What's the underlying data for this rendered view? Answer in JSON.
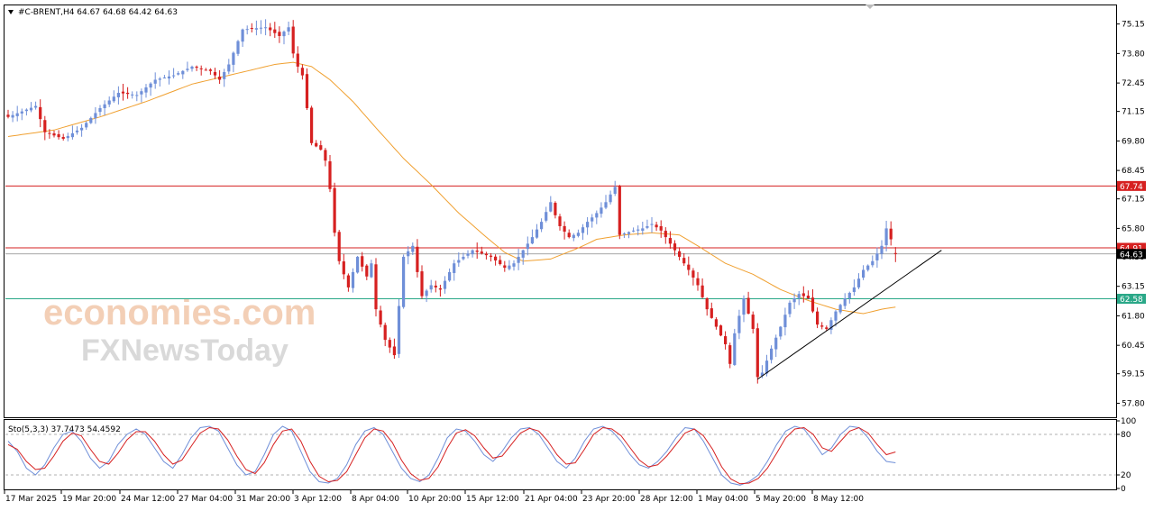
{
  "header": {
    "symbol_line": "#C-BRENT,H4  64.67 64.68 64.42 64.63"
  },
  "watermark": {
    "line1": "economies.com",
    "line2": "FXNewsToday"
  },
  "colors": {
    "bull": "#6f8fd8",
    "bear": "#d62020",
    "ma": "#f0a030",
    "resistance": "#d62020",
    "support": "#2aa888",
    "price_line": "#888888",
    "trendline": "#000000",
    "stoch_main": "#6f8fd8",
    "stoch_signal": "#d62020"
  },
  "chart_data": [
    {
      "type": "candlestick",
      "title": "#C-BRENT,H4",
      "ohlc_header": {
        "open": 64.67,
        "high": 64.68,
        "low": 64.42,
        "close": 64.63
      },
      "ylim": [
        57.2,
        76.0
      ],
      "yticks": [
        "75.15",
        "73.80",
        "72.45",
        "71.15",
        "69.80",
        "68.45",
        "67.15",
        "65.80",
        "64.50",
        "63.15",
        "61.80",
        "60.45",
        "59.15",
        "57.80"
      ],
      "x_labels": [
        "17 Mar 2025",
        "19 Mar 20:00",
        "24 Mar 12:00",
        "27 Mar 04:00",
        "31 Mar 20:00",
        "3 Apr 12:00",
        "8 Apr 04:00",
        "10 Apr 20:00",
        "15 Apr 12:00",
        "21 Apr 04:00",
        "23 Apr 20:00",
        "28 Apr 12:00",
        "1 May 04:00",
        "5 May 20:00",
        "8 May 12:00"
      ],
      "horizontal_levels": [
        {
          "label": "67.74",
          "value": 67.74,
          "kind": "resistance"
        },
        {
          "label": "64.91",
          "value": 64.91,
          "kind": "resistance"
        },
        {
          "label": "64.63",
          "value": 64.63,
          "kind": "current"
        },
        {
          "label": "62.58",
          "value": 62.58,
          "kind": "support"
        }
      ],
      "trendline": {
        "from": {
          "bar": 163,
          "price": 58.9
        },
        "to": {
          "bar": 203,
          "price": 64.8
        }
      },
      "close_path": [
        [
          0,
          70.9
        ],
        [
          6,
          71.4
        ],
        [
          8,
          70.2
        ],
        [
          12,
          69.9
        ],
        [
          16,
          70.4
        ],
        [
          20,
          71.3
        ],
        [
          24,
          72.0
        ],
        [
          28,
          71.9
        ],
        [
          32,
          72.6
        ],
        [
          36,
          72.8
        ],
        [
          40,
          73.2
        ],
        [
          44,
          73.0
        ],
        [
          46,
          72.6
        ],
        [
          48,
          73.3
        ],
        [
          51,
          74.9
        ],
        [
          56,
          75.0
        ],
        [
          59,
          74.6
        ],
        [
          61,
          75.0
        ],
        [
          62,
          73.8
        ],
        [
          63,
          73.2
        ],
        [
          64,
          72.8
        ],
        [
          65,
          71.3
        ],
        [
          66,
          69.7
        ],
        [
          68,
          69.4
        ],
        [
          69,
          68.9
        ],
        [
          70,
          67.6
        ],
        [
          71,
          65.6
        ],
        [
          72,
          64.3
        ],
        [
          74,
          63.1
        ],
        [
          76,
          64.5
        ],
        [
          78,
          63.6
        ],
        [
          79,
          64.2
        ],
        [
          80,
          62.1
        ],
        [
          82,
          60.7
        ],
        [
          84,
          60.0
        ],
        [
          86,
          64.5
        ],
        [
          88,
          65.0
        ],
        [
          89,
          63.8
        ],
        [
          90,
          62.7
        ],
        [
          92,
          63.2
        ],
        [
          94,
          63.0
        ],
        [
          97,
          64.2
        ],
        [
          101,
          64.8
        ],
        [
          105,
          64.5
        ],
        [
          108,
          64.0
        ],
        [
          110,
          64.2
        ],
        [
          112,
          64.8
        ],
        [
          114,
          65.4
        ],
        [
          116,
          66.1
        ],
        [
          118,
          67.0
        ],
        [
          119,
          66.4
        ],
        [
          120,
          65.9
        ],
        [
          122,
          65.4
        ],
        [
          124,
          65.6
        ],
        [
          126,
          66.1
        ],
        [
          128,
          66.5
        ],
        [
          130,
          67.0
        ],
        [
          132,
          67.7
        ],
        [
          133,
          65.5
        ],
        [
          136,
          65.7
        ],
        [
          138,
          65.8
        ],
        [
          140,
          66.0
        ],
        [
          142,
          65.7
        ],
        [
          144,
          65.1
        ],
        [
          146,
          64.5
        ],
        [
          148,
          63.9
        ],
        [
          150,
          63.2
        ],
        [
          152,
          62.1
        ],
        [
          154,
          61.3
        ],
        [
          156,
          60.5
        ],
        [
          157,
          59.6
        ],
        [
          158,
          61.0
        ],
        [
          160,
          62.6
        ],
        [
          162,
          61.2
        ],
        [
          163,
          59.0
        ],
        [
          164,
          59.2
        ],
        [
          166,
          60.3
        ],
        [
          168,
          61.3
        ],
        [
          170,
          62.4
        ],
        [
          172,
          62.8
        ],
        [
          174,
          62.6
        ],
        [
          176,
          61.4
        ],
        [
          178,
          61.2
        ],
        [
          180,
          62.0
        ],
        [
          182,
          62.6
        ],
        [
          184,
          63.1
        ],
        [
          186,
          63.9
        ],
        [
          188,
          64.3
        ],
        [
          190,
          65.0
        ],
        [
          191,
          65.8
        ],
        [
          192,
          65.3
        ],
        [
          193,
          64.63
        ]
      ],
      "ma_path": [
        [
          0,
          70.0
        ],
        [
          10,
          70.3
        ],
        [
          20,
          70.9
        ],
        [
          30,
          71.6
        ],
        [
          40,
          72.4
        ],
        [
          50,
          72.9
        ],
        [
          58,
          73.3
        ],
        [
          62,
          73.4
        ],
        [
          66,
          73.2
        ],
        [
          70,
          72.6
        ],
        [
          75,
          71.6
        ],
        [
          80,
          70.4
        ],
        [
          86,
          69.0
        ],
        [
          92,
          67.8
        ],
        [
          98,
          66.5
        ],
        [
          104,
          65.4
        ],
        [
          108,
          64.7
        ],
        [
          112,
          64.3
        ],
        [
          118,
          64.4
        ],
        [
          124,
          64.9
        ],
        [
          128,
          65.3
        ],
        [
          134,
          65.5
        ],
        [
          140,
          65.6
        ],
        [
          146,
          65.5
        ],
        [
          150,
          65.0
        ],
        [
          156,
          64.2
        ],
        [
          162,
          63.7
        ],
        [
          168,
          63.0
        ],
        [
          174,
          62.5
        ],
        [
          180,
          62.1
        ],
        [
          186,
          61.9
        ],
        [
          190,
          62.1
        ],
        [
          193,
          62.2
        ]
      ],
      "ma_period_label": ""
    },
    {
      "type": "line",
      "title": "Sto(5,3,3) 37.7473 54.4592",
      "indicator": "Stochastic",
      "params": "5,3,3",
      "main_value": 37.7473,
      "signal_value": 54.4592,
      "ylim": [
        0,
        100
      ],
      "yticks": [
        "100",
        "80",
        "20",
        "0"
      ],
      "levels": [
        80,
        20
      ],
      "series": [
        {
          "name": "%K",
          "values": [
            70,
            55,
            30,
            20,
            35,
            60,
            80,
            85,
            70,
            45,
            30,
            40,
            65,
            80,
            88,
            80,
            60,
            40,
            30,
            50,
            75,
            90,
            92,
            85,
            60,
            35,
            20,
            25,
            50,
            80,
            92,
            85,
            55,
            25,
            10,
            8,
            15,
            35,
            65,
            85,
            90,
            80,
            55,
            30,
            15,
            10,
            20,
            45,
            75,
            88,
            85,
            70,
            50,
            40,
            55,
            75,
            88,
            90,
            80,
            60,
            40,
            30,
            45,
            70,
            88,
            92,
            85,
            70,
            50,
            35,
            30,
            40,
            55,
            75,
            90,
            88,
            70,
            45,
            20,
            8,
            5,
            10,
            20,
            40,
            65,
            85,
            92,
            88,
            70,
            50,
            60,
            80,
            92,
            90,
            75,
            55,
            40,
            38
          ]
        },
        {
          "name": "%D",
          "values": [
            65,
            58,
            40,
            28,
            30,
            48,
            70,
            82,
            78,
            58,
            40,
            36,
            52,
            72,
            84,
            84,
            70,
            50,
            36,
            42,
            62,
            82,
            90,
            88,
            72,
            48,
            28,
            22,
            38,
            65,
            85,
            88,
            70,
            40,
            18,
            10,
            12,
            25,
            50,
            75,
            88,
            85,
            68,
            42,
            22,
            12,
            15,
            32,
            60,
            82,
            87,
            78,
            60,
            45,
            48,
            65,
            82,
            89,
            85,
            70,
            50,
            36,
            38,
            58,
            80,
            90,
            88,
            78,
            60,
            42,
            32,
            35,
            48,
            65,
            82,
            88,
            78,
            58,
            32,
            14,
            7,
            8,
            15,
            30,
            52,
            75,
            88,
            90,
            80,
            60,
            55,
            70,
            85,
            90,
            82,
            65,
            50,
            54
          ]
        }
      ]
    }
  ]
}
